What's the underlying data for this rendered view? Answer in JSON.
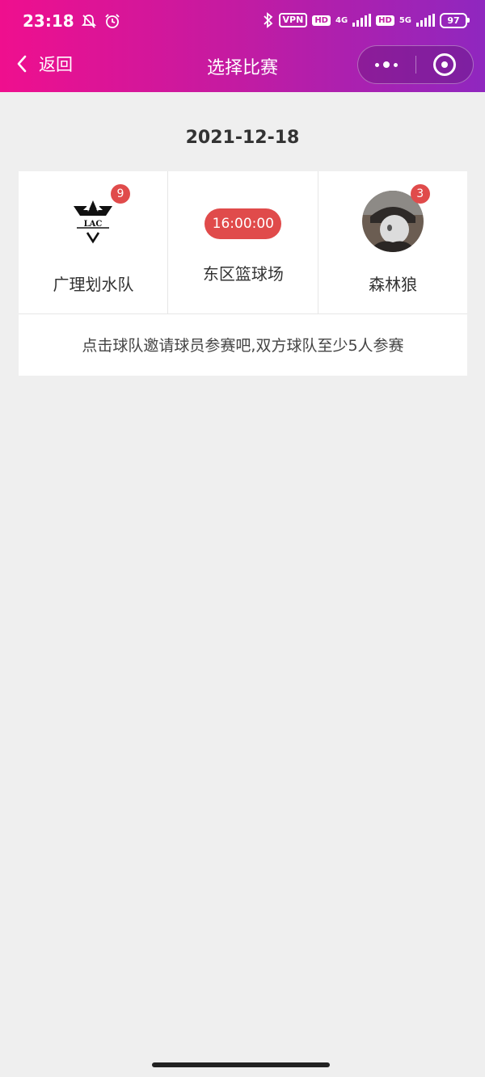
{
  "status_bar": {
    "time": "23:18",
    "vpn": "VPN",
    "hd1": "HD",
    "net1": "4G",
    "hd2": "HD",
    "net2": "5G",
    "battery": "97"
  },
  "nav": {
    "back_label": "返回",
    "title": "选择比赛"
  },
  "match_date": "2021-12-18",
  "match": {
    "home_team": {
      "name": "广理划水队",
      "count": "9",
      "logo_text": "LAC"
    },
    "time": "16:00:00",
    "venue": "东区篮球场",
    "away_team": {
      "name": "森林狼",
      "count": "3"
    }
  },
  "hint": "点击球队邀请球员参赛吧,双方球队至少5人参赛",
  "colors": {
    "badge": "#e04b4b",
    "gradient_start": "#ef0f8e",
    "gradient_end": "#8f27bf"
  }
}
